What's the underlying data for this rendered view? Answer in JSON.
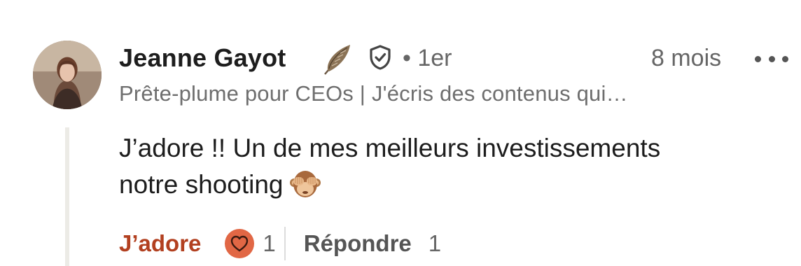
{
  "comment": {
    "author": {
      "name": "Jeanne Gayot",
      "headline": "Prête-plume pour CEOs | J'écris des contenus qui…",
      "connection_degree": "• 1er",
      "avatar_icon": "profile-photo",
      "badge_icon": "feather-icon",
      "verified_icon": "verified-shield-icon"
    },
    "timestamp": "8 mois",
    "more_icon": "more-dots-icon",
    "text_line1": "J’adore !! Un de mes meilleurs investissements",
    "text_line2": "notre shooting",
    "emoji": "see-no-evil-monkey",
    "actions": {
      "like_label": "J’adore",
      "reaction_icon": "heart-icon",
      "reaction_count": "1",
      "reply_label": "Répondre",
      "reply_count": "1"
    }
  },
  "colors": {
    "like": "#b24020",
    "reaction_bg": "#e16745",
    "muted": "#666666"
  }
}
